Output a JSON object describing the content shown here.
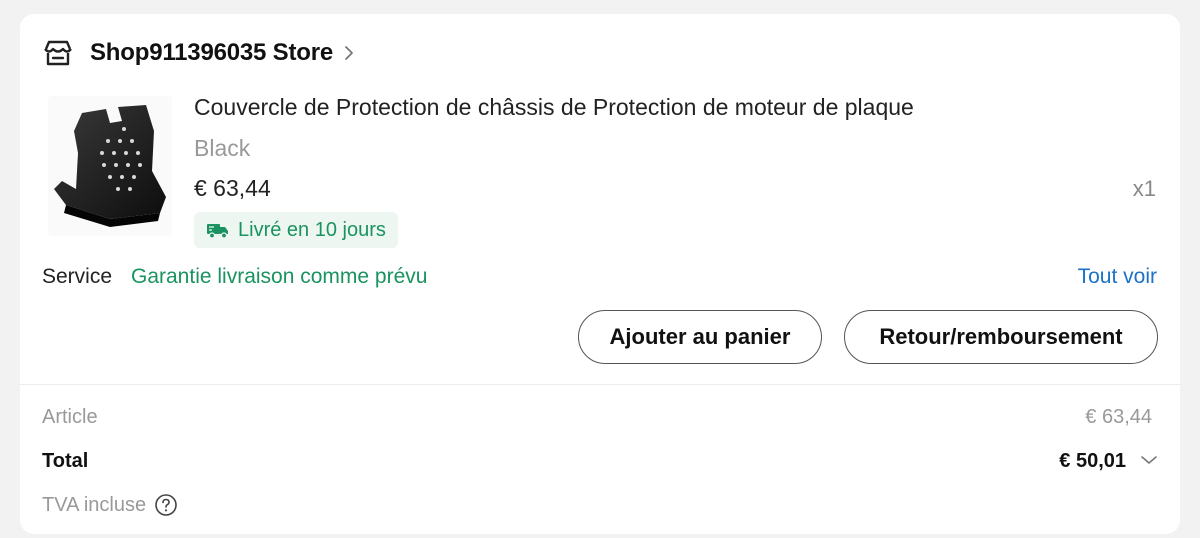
{
  "store": {
    "name": "Shop911396035 Store",
    "icon": "store-icon"
  },
  "product": {
    "title": "Couvercle de Protection de châssis de Protection de moteur de plaque",
    "variant": "Black",
    "price": "€ 63,44",
    "quantity": "x1",
    "delivery": "Livré en 10 jours"
  },
  "service": {
    "label": "Service",
    "value": "Garantie livraison comme prévu",
    "see_all": "Tout voir"
  },
  "actions": {
    "add_to_cart": "Ajouter au panier",
    "return_refund": "Retour/remboursement"
  },
  "summary": {
    "article_label": "Article",
    "article_value": "€ 63,44",
    "total_label": "Total",
    "total_value": "€ 50,01",
    "tva_label": "TVA incluse"
  },
  "colors": {
    "green": "#1b9360",
    "link_blue": "#1a73c8",
    "muted": "#999999"
  }
}
